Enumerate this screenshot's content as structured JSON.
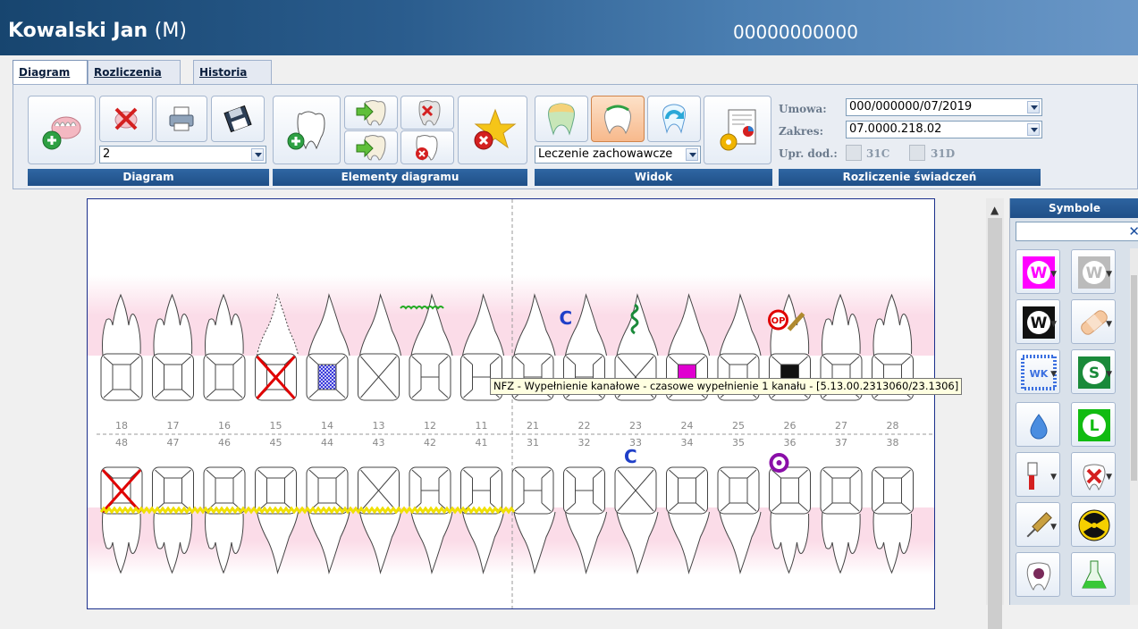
{
  "patient": {
    "name": "Kowalski Jan",
    "sex": "(M)",
    "pesel": "00000000000"
  },
  "tabs": [
    {
      "label": "Diagram",
      "active": true
    },
    {
      "label": "Rozliczenia",
      "active": false
    },
    {
      "label": "Historia",
      "active": false
    }
  ],
  "ribbon": {
    "diagram_group": {
      "label": "Diagram",
      "combo_value": "2"
    },
    "elements_group": {
      "label": "Elementy diagramu"
    },
    "view_group": {
      "label": "Widok",
      "combo_value": "Leczenie zachowawcze"
    },
    "billing_group": {
      "label": "Rozliczenie świadczeń",
      "umowa_label": "Umowa:",
      "umowa_value": "000/000000/07/2019",
      "zakres_label": "Zakres:",
      "zakres_value": "07.0000.218.02",
      "upr_label": "Upr. dod.:",
      "upr_31c": "31C",
      "upr_31d": "31D"
    }
  },
  "diagram": {
    "upper_numbers": [
      "18",
      "17",
      "16",
      "15",
      "14",
      "13",
      "12",
      "11",
      "21",
      "22",
      "23",
      "24",
      "25",
      "26",
      "27",
      "28"
    ],
    "lower_numbers": [
      "48",
      "47",
      "46",
      "45",
      "44",
      "43",
      "42",
      "41",
      "31",
      "32",
      "33",
      "34",
      "35",
      "36",
      "37",
      "38"
    ],
    "tooltip": "NFZ - Wypełnienie kanałowe - czasowe wypełnienie 1 kanału - [5.13.00.2313060/23.1306]",
    "marker_c": "C",
    "marker_op": "OP"
  },
  "symbols": {
    "title": "Symbole",
    "search_value": "",
    "items": [
      "w-magenta",
      "w-gray",
      "w-black",
      "bandage",
      "wk-blue",
      "s-green",
      "drop",
      "l-green",
      "toothbrush",
      "tooth-x",
      "syringe",
      "radiation",
      "tooth-skull",
      "flask"
    ]
  },
  "colors": {
    "title_bar": "#1f4f7f",
    "ribbon_label": "#1f4f87",
    "accent_selected": "#f7b98c",
    "gum_pink": "#fbe0ea"
  }
}
